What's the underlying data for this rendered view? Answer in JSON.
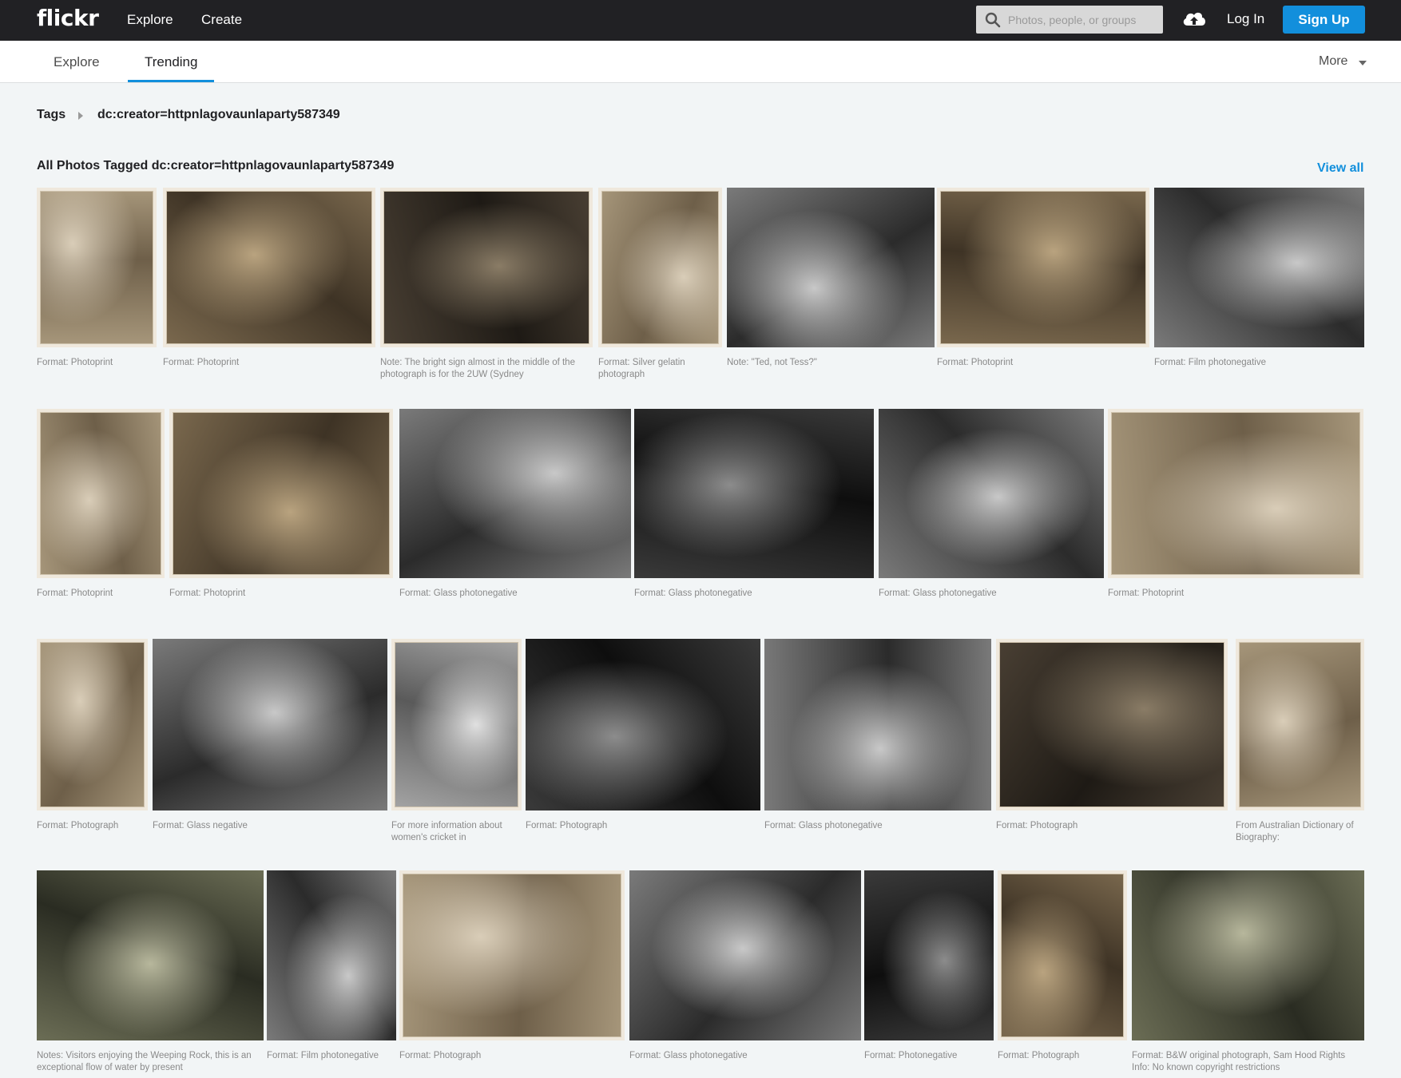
{
  "nav": {
    "logo": "flickr",
    "explore": "Explore",
    "create": "Create",
    "search_placeholder": "Photos, people, or groups",
    "login": "Log In",
    "signup": "Sign Up"
  },
  "subnav": {
    "tabs": [
      "Explore",
      "Trending"
    ],
    "active_tab": "Trending",
    "more": "More"
  },
  "breadcrumb": {
    "root": "Tags",
    "current": "dc:creator=httpnlagovaunlaparty587349"
  },
  "section": {
    "title": "All Photos Tagged dc:creator=httpnlagovaunlaparty587349",
    "view_all": "View all"
  },
  "colors": {
    "accent": "#128fdc",
    "topbar": "#212124",
    "page_bg": "#f2f5f6"
  },
  "photos": [
    {
      "caption": "Format: Photoprint",
      "tone": "sepia-light"
    },
    {
      "caption": "Format: Photoprint",
      "tone": "sepia"
    },
    {
      "caption": "Note: The bright sign almost in the middle of the photograph is for the 2UW (Sydney",
      "tone": "sepia-dark"
    },
    {
      "caption": "Format: Silver gelatin photograph",
      "tone": "sepia-light"
    },
    {
      "caption": "Note: \"Ted, not Tess?\"",
      "tone": "bw"
    },
    {
      "caption": "Format: Photoprint",
      "tone": "sepia"
    },
    {
      "caption": "Format: Film photonegative",
      "tone": "bw"
    },
    {
      "caption": "Format: Photoprint",
      "tone": "sepia-light"
    },
    {
      "caption": "Format: Photoprint",
      "tone": "sepia"
    },
    {
      "caption": "Format: Glass photonegative",
      "tone": "bw"
    },
    {
      "caption": "Format: Glass photonegative",
      "tone": "bw-dark"
    },
    {
      "caption": "Format: Glass photonegative",
      "tone": "bw"
    },
    {
      "caption": "Format: Photoprint",
      "tone": "sepia-light"
    },
    {
      "caption": "Format: Photograph",
      "tone": "sepia-light"
    },
    {
      "caption": "Format: Glass negative",
      "tone": "bw"
    },
    {
      "caption": "For more information about women's cricket in",
      "tone": "bw-light"
    },
    {
      "caption": "Format: Photograph",
      "tone": "bw-dark"
    },
    {
      "caption": "Format: Glass photonegative",
      "tone": "bw"
    },
    {
      "caption": "Format: Photograph",
      "tone": "sepia-dark"
    },
    {
      "caption": "From Australian Dictionary of Biography:",
      "tone": "sepia-light"
    },
    {
      "caption": "Notes: Visitors enjoying the Weeping Rock, this is an exceptional flow of water by present",
      "tone": "green"
    },
    {
      "caption": "Format: Film photonegative",
      "tone": "bw"
    },
    {
      "caption": "Format: Photograph",
      "tone": "sepia-light"
    },
    {
      "caption": "Format: Glass photonegative",
      "tone": "bw"
    },
    {
      "caption": "Format: Photonegative",
      "tone": "bw-dark"
    },
    {
      "caption": "Format: Photograph",
      "tone": "sepia"
    },
    {
      "caption": "Format: B&W original photograph, Sam Hood Rights Info: No known copyright restrictions",
      "tone": "green"
    }
  ]
}
